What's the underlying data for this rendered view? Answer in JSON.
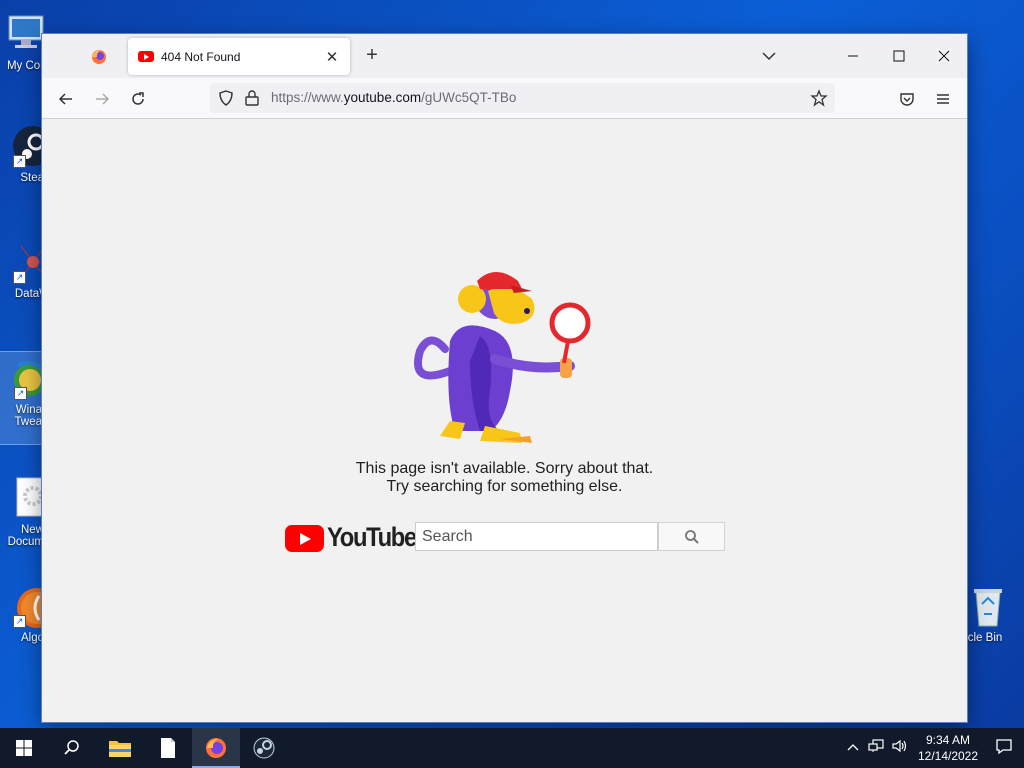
{
  "desktop": {
    "icons": [
      {
        "label": "My Cor",
        "name": "my-computer"
      },
      {
        "label": "Stea",
        "name": "steam"
      },
      {
        "label": "DataWa",
        "name": "datawatch"
      },
      {
        "label": "Wina\nTwea",
        "name": "winaero-tweaker"
      },
      {
        "label": "New\nDocum",
        "name": "new-document"
      },
      {
        "label": "Algo",
        "name": "algodoo"
      },
      {
        "label": "ycle Bin",
        "name": "recycle-bin"
      }
    ]
  },
  "browser": {
    "tab_title": "404 Not Found",
    "url": "https://www.youtube.com/gUWc5QT-TBo",
    "url_prefix": "https://www.",
    "url_domain": "youtube.com",
    "url_path": "/gUWc5QT-TBo"
  },
  "page": {
    "message_line1": "This page isn't available. Sorry about that.",
    "message_line2": "Try searching for something else.",
    "logo_text": "YouTube",
    "search_placeholder": "Search"
  },
  "colors": {
    "youtube_red": "#ff0000",
    "desktop_blue": "#0b5fd6",
    "taskbar": "#101a2a"
  },
  "taskbar": {
    "time": "9:34 AM",
    "date": "12/14/2022"
  }
}
